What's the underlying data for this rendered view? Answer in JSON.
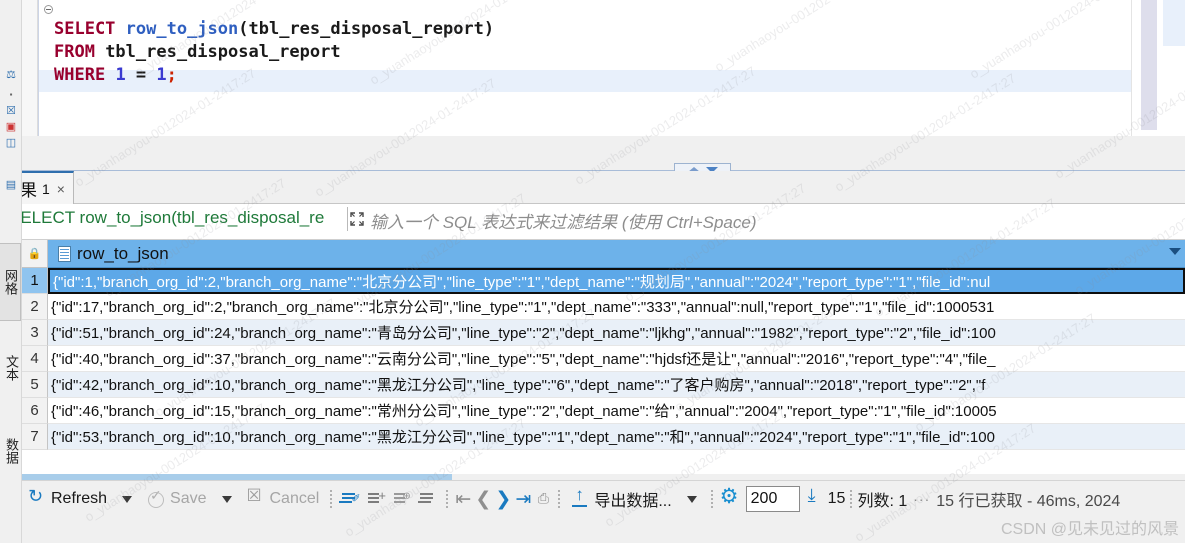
{
  "left_rail": {
    "tabs": [
      {
        "name": "grid",
        "label": "网格",
        "active": true
      },
      {
        "name": "text",
        "label": "文本",
        "active": false
      },
      {
        "name": "record",
        "label": "数据",
        "active": false
      }
    ]
  },
  "sql_editor": {
    "lines": [
      {
        "tokens": [
          {
            "t": "SELECT",
            "c": "kw"
          },
          {
            "t": " ",
            "c": "plain"
          },
          {
            "t": "row_to_json",
            "c": "fn"
          },
          {
            "t": "(tbl_res_disposal_report)",
            "c": "plain"
          }
        ]
      },
      {
        "tokens": [
          {
            "t": "FROM",
            "c": "kw"
          },
          {
            "t": " tbl_res_disposal_report",
            "c": "plain"
          }
        ]
      },
      {
        "tokens": [
          {
            "t": "WHERE",
            "c": "kw"
          },
          {
            "t": " ",
            "c": "plain"
          },
          {
            "t": "1",
            "c": "num"
          },
          {
            "t": " = ",
            "c": "plain"
          },
          {
            "t": "1",
            "c": "num"
          },
          {
            "t": ";",
            "c": "semi"
          }
        ]
      }
    ]
  },
  "result_tab": {
    "label": "结果",
    "number": "1",
    "close": "×"
  },
  "filter": {
    "prefix_icon": "filter-t-icon",
    "query": "SELECT row_to_json(tbl_res_disposal_re",
    "placeholder": "输入一个 SQL 表达式来过滤结果 (使用 Ctrl+Space)"
  },
  "grid": {
    "column_header": "row_to_json",
    "rows": [
      {
        "n": "1",
        "value": "{\"id\":1,\"branch_org_id\":2,\"branch_org_name\":\"北京分公司\",\"line_type\":\"1\",\"dept_name\":\"规划局\",\"annual\":\"2024\",\"report_type\":\"1\",\"file_id\":nul",
        "selected": true
      },
      {
        "n": "2",
        "value": "{\"id\":17,\"branch_org_id\":2,\"branch_org_name\":\"北京分公司\",\"line_type\":\"1\",\"dept_name\":\"333\",\"annual\":null,\"report_type\":\"1\",\"file_id\":1000531",
        "selected": false
      },
      {
        "n": "3",
        "value": "{\"id\":51,\"branch_org_id\":24,\"branch_org_name\":\"青岛分公司\",\"line_type\":\"2\",\"dept_name\":\"ljkhg\",\"annual\":\"1982\",\"report_type\":\"2\",\"file_id\":100",
        "selected": false
      },
      {
        "n": "4",
        "value": "{\"id\":40,\"branch_org_id\":37,\"branch_org_name\":\"云南分公司\",\"line_type\":\"5\",\"dept_name\":\"hjdsf还是让\",\"annual\":\"2016\",\"report_type\":\"4\",\"file_",
        "selected": false
      },
      {
        "n": "5",
        "value": "{\"id\":42,\"branch_org_id\":10,\"branch_org_name\":\"黑龙江分公司\",\"line_type\":\"6\",\"dept_name\":\"了客户购房\",\"annual\":\"2018\",\"report_type\":\"2\",\"f",
        "selected": false
      },
      {
        "n": "6",
        "value": "{\"id\":46,\"branch_org_id\":15,\"branch_org_name\":\"常州分公司\",\"line_type\":\"2\",\"dept_name\":\"给\",\"annual\":\"2004\",\"report_type\":\"1\",\"file_id\":10005",
        "selected": false
      },
      {
        "n": "7",
        "value": "{\"id\":53,\"branch_org_id\":10,\"branch_org_name\":\"黑龙江分公司\",\"line_type\":\"1\",\"dept_name\":\"和\",\"annual\":\"2024\",\"report_type\":\"1\",\"file_id\":100",
        "selected": false
      }
    ]
  },
  "toolbar": {
    "refresh_label": "Refresh",
    "save_label": "Save",
    "cancel_label": "Cancel",
    "export_label": "导出数据...",
    "fetch_size_value": "200",
    "fetch_count": "15",
    "columns_label": "列数: 1",
    "status": "15 行已获取 - 46ms, 2024",
    "dots": "···"
  },
  "watermarks": {
    "csdn": "CSDN @见未见过的风景",
    "repeat": "o_yuanhaoyou-0012024-01-2417:27"
  }
}
